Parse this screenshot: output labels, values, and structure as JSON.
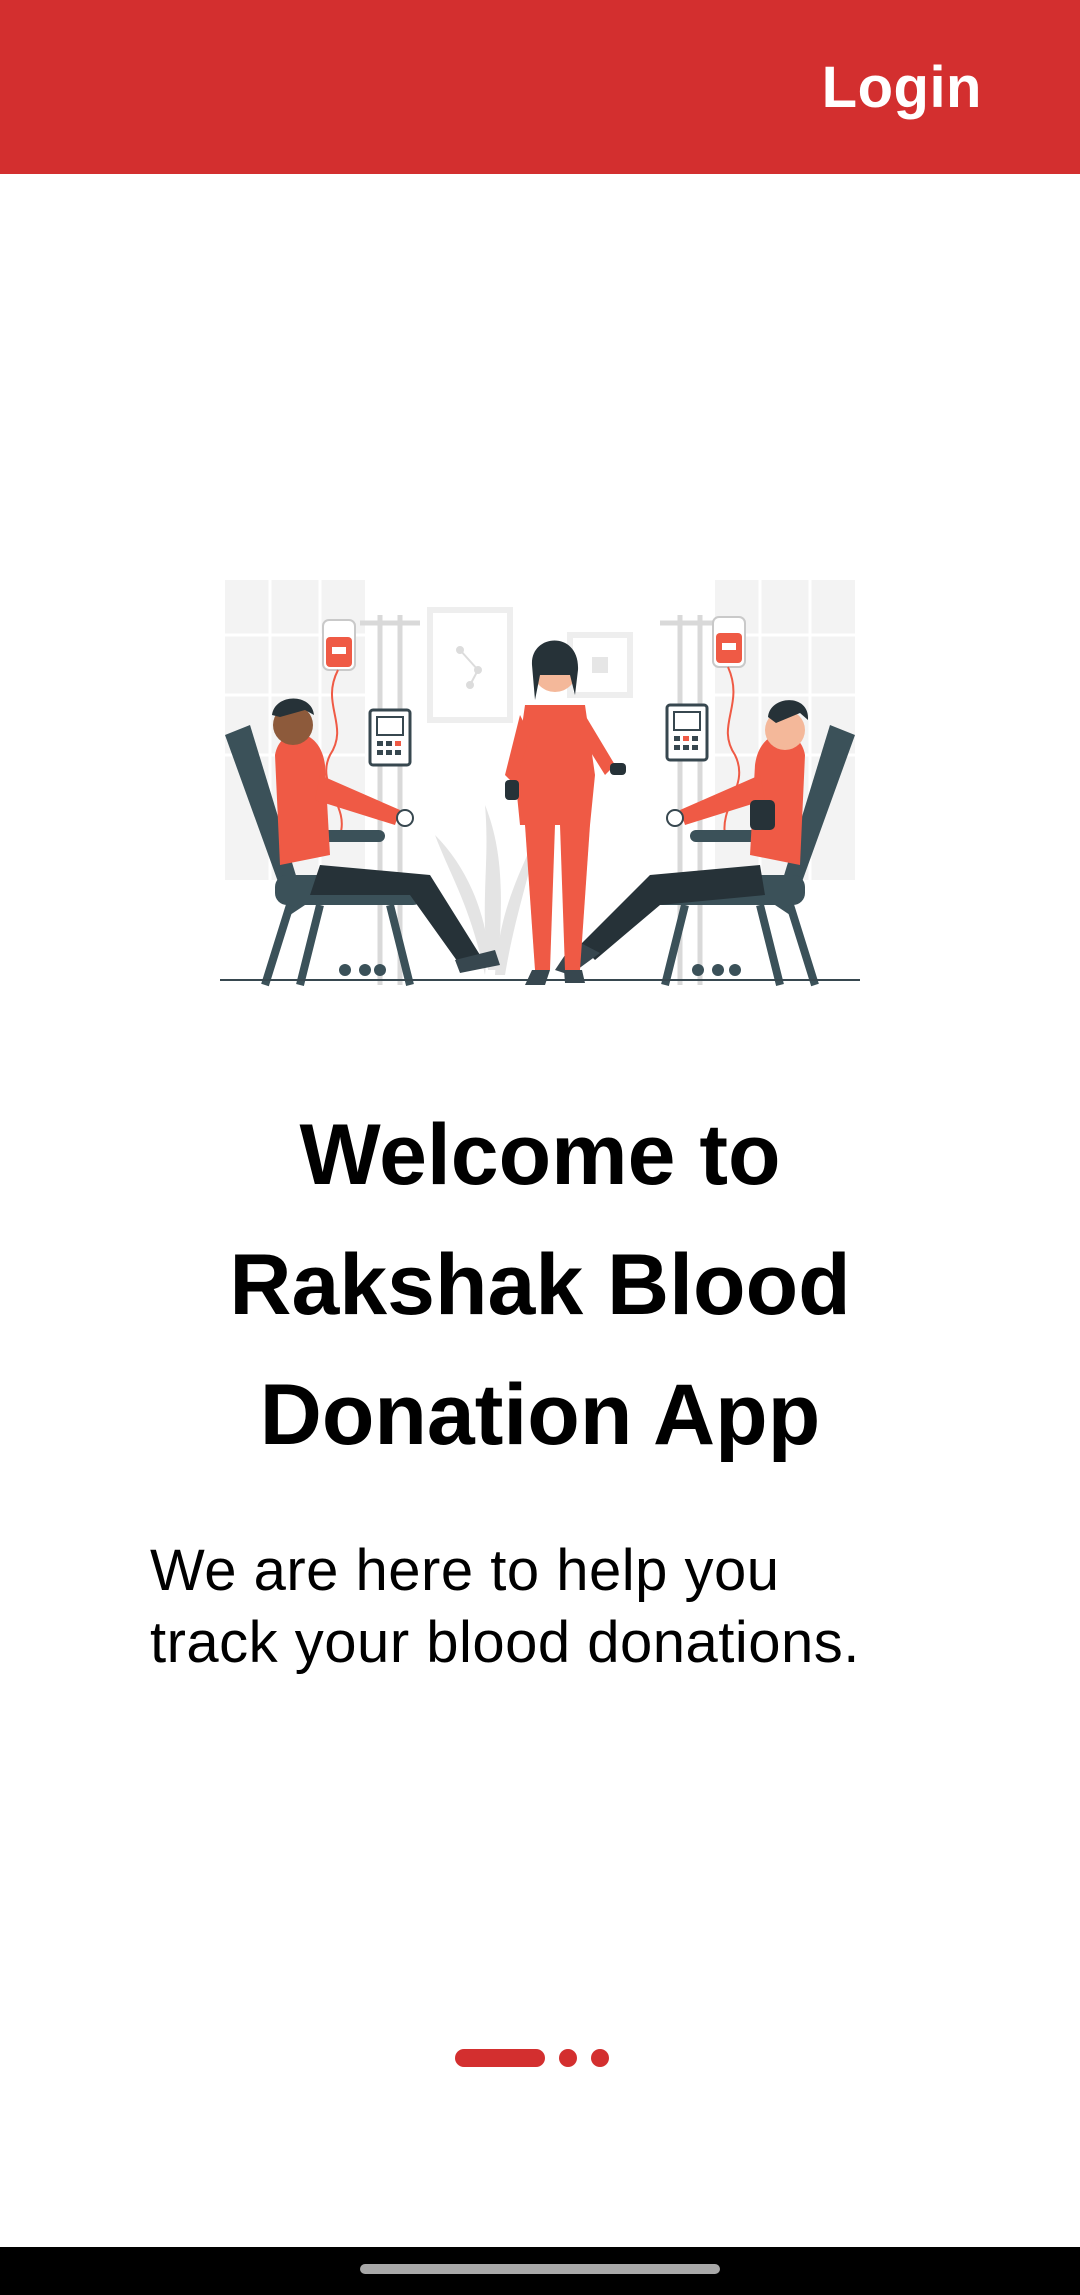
{
  "app_bar": {
    "login_label": "Login",
    "color": "#d32f2f"
  },
  "illustration": {
    "icon": "blood-donation-illustration"
  },
  "welcome": {
    "title_line1": "Welcome to",
    "title_line2": "Rakshak Blood",
    "title_line3": "Donation App",
    "subtitle_line1": "We are here to help you",
    "subtitle_line2": "track your blood donations."
  },
  "pager": {
    "total_pages": 3,
    "current_page": 1
  }
}
